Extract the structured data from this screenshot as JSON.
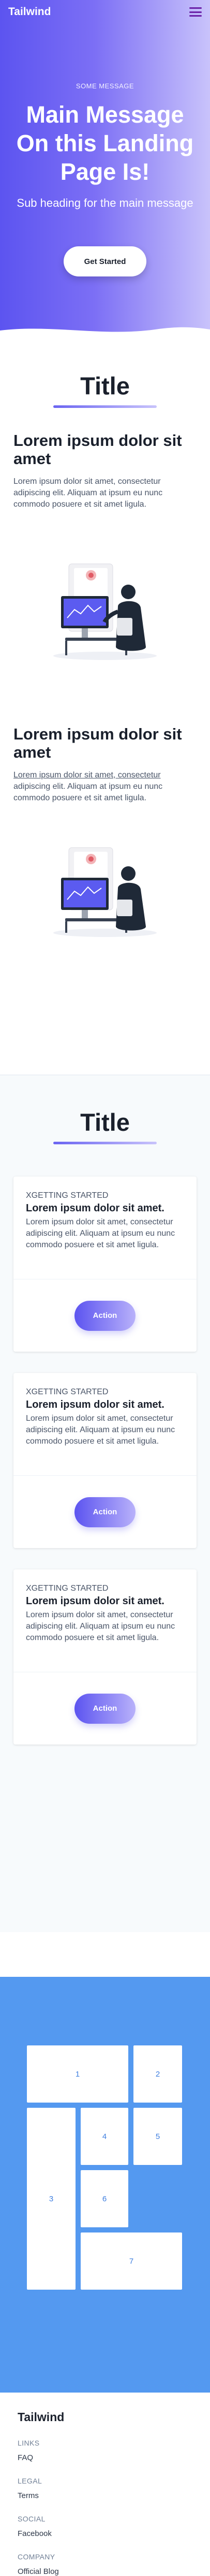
{
  "nav": {
    "brand": "Tailwind"
  },
  "hero": {
    "kicker": "SOME MESSAGE",
    "title": "Main Message On this Landing Page Is!",
    "subtitle": "Sub heading for the main message",
    "cta_label": "Get Started"
  },
  "features": {
    "title": "Title",
    "items": [
      {
        "heading": "Lorem ipsum dolor sit amet",
        "body": "Lorem ipsum dolor sit amet, consectetur adipiscing elit. Aliquam at ipsum eu nunc commodo posuere et sit amet ligula."
      },
      {
        "heading": "Lorem ipsum dolor sit amet",
        "body_underlined": "Lorem ipsum dolor sit amet, consectetur",
        "body_rest": " adipiscing elit. Aliquam at ipsum eu nunc commodo posuere et sit amet ligula."
      }
    ]
  },
  "cards": {
    "title": "Title",
    "items": [
      {
        "kicker": "xGETTING STARTED",
        "heading": "Lorem ipsum dolor sit amet.",
        "body": "Lorem ipsum dolor sit amet, consectetur adipiscing elit. Aliquam at ipsum eu nunc commodo posuere et sit amet ligula.",
        "action": "Action"
      },
      {
        "kicker": "xGETTING STARTED",
        "heading": "Lorem ipsum dolor sit amet.",
        "body": "Lorem ipsum dolor sit amet, consectetur adipiscing elit. Aliquam at ipsum eu nunc commodo posuere et sit amet ligula.",
        "action": "Action"
      },
      {
        "kicker": "xGETTING STARTED",
        "heading": "Lorem ipsum dolor sit amet.",
        "body": "Lorem ipsum dolor sit amet, consectetur adipiscing elit. Aliquam at ipsum eu nunc commodo posuere et sit amet ligula.",
        "action": "Action"
      }
    ]
  },
  "grid": {
    "tiles": [
      "1",
      "2",
      "3",
      "4",
      "5",
      "6",
      "7"
    ]
  },
  "footer": {
    "brand": "Tailwind",
    "groups": [
      {
        "heading": "LINKS",
        "link": "FAQ"
      },
      {
        "heading": "LEGAL",
        "link": "Terms"
      },
      {
        "heading": "SOCIAL",
        "link": "Facebook"
      },
      {
        "heading": "COMPANY",
        "link": "Official Blog"
      }
    ]
  },
  "colors": {
    "accent": "#5c54f0",
    "grid_bg": "#5499f0",
    "menu_icon": "#6b21a8"
  }
}
